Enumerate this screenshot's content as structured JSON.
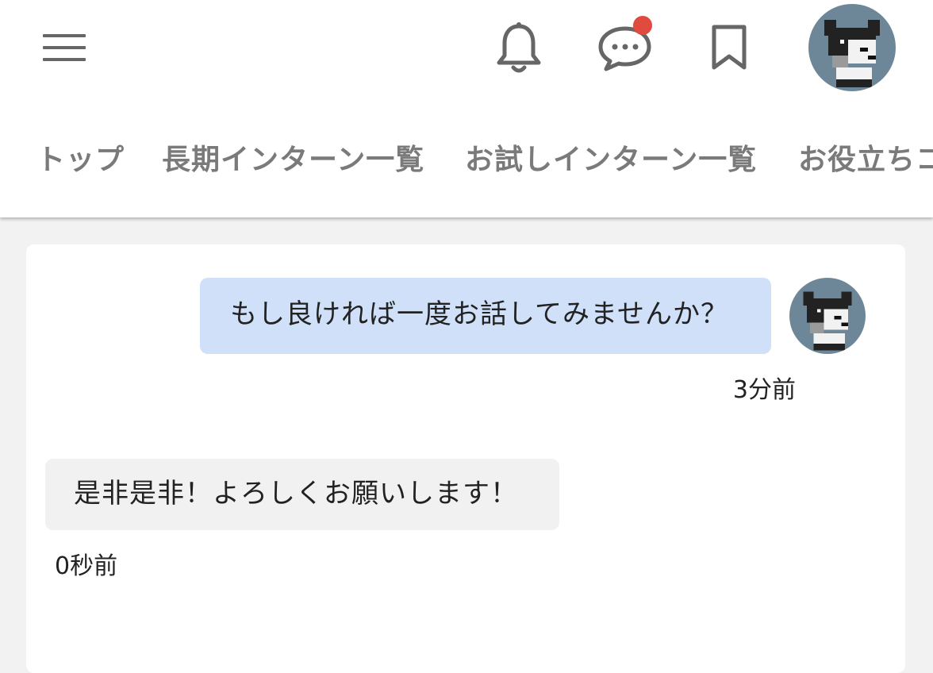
{
  "header": {
    "icons": {
      "menu": "hamburger-menu-icon",
      "notifications": "bell-icon",
      "messages": "chat-bubble-icon",
      "bookmarks": "bookmark-icon",
      "avatar": "pixel-dog-avatar"
    },
    "messages_has_unread": true,
    "colors": {
      "icon": "#666666",
      "unread_dot": "#e04a3f",
      "avatar_bg": "#6e8798"
    }
  },
  "nav": {
    "tabs": [
      {
        "label": "トップ"
      },
      {
        "label": "長期インターン一覧"
      },
      {
        "label": "お試しインターン一覧"
      },
      {
        "label": "お役立ちコ"
      }
    ]
  },
  "chat": {
    "messages": [
      {
        "direction": "sent",
        "text": "もし良ければ一度お話してみませんか？",
        "time": "3分前"
      },
      {
        "direction": "received",
        "text": "是非是非！よろしくお願いします！",
        "time": "0秒前"
      }
    ],
    "colors": {
      "sent_bubble": "#cfe0f8",
      "received_bubble": "#f1f1f1",
      "page_bg": "#f2f2f2"
    }
  }
}
